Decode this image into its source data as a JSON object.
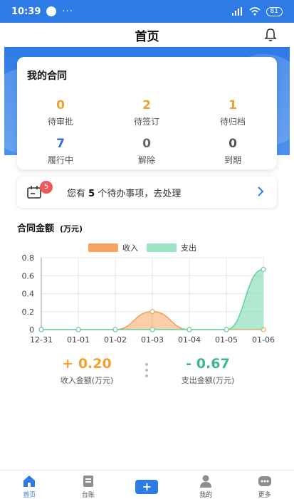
{
  "status_bar": {
    "time": "10:39",
    "dots": "···",
    "battery": "81"
  },
  "nav": {
    "title": "首页"
  },
  "contract_card": {
    "title": "我的合同",
    "stats": [
      {
        "value": "0",
        "label": "待审批",
        "color": "#f0a030"
      },
      {
        "value": "2",
        "label": "待签订",
        "color": "#f0a030"
      },
      {
        "value": "1",
        "label": "待归档",
        "color": "#f0a030"
      },
      {
        "value": "7",
        "label": "履行中",
        "color": "#2f6fd0"
      },
      {
        "value": "0",
        "label": "解除",
        "color": "#666666"
      },
      {
        "value": "0",
        "label": "到期",
        "color": "#555555"
      }
    ]
  },
  "todo": {
    "badge": "5",
    "prefix": "您有 ",
    "count": "5",
    "suffix": " 个待办事项，去处理"
  },
  "amount": {
    "title": "合同金额",
    "unit": "(万元)"
  },
  "chart_data": {
    "type": "area",
    "x": [
      "12-31",
      "01-01",
      "01-02",
      "01-03",
      "01-04",
      "01-05",
      "01-06"
    ],
    "series": [
      {
        "name": "收入",
        "values": [
          0,
          0,
          0,
          0.2,
          0,
          0,
          0
        ],
        "color": "#f5a55f"
      },
      {
        "name": "支出",
        "values": [
          0,
          0,
          0,
          0,
          0,
          0,
          0.67
        ],
        "color": "#7bd9b0"
      }
    ],
    "yticks": [
      "0",
      "0.2",
      "0.4",
      "0.6",
      "0.8"
    ],
    "ylim": [
      0,
      0.8
    ],
    "grid": true,
    "legend": "top-center"
  },
  "totals": {
    "income": {
      "value": "+ 0.20",
      "label": "收入金额(万元)",
      "color": "#f0a030"
    },
    "expense": {
      "value": "- 0.67",
      "label": "支出金额(万元)",
      "color": "#3cb88a"
    }
  },
  "tabs": [
    {
      "label": "首页",
      "icon": "home-icon"
    },
    {
      "label": "台账",
      "icon": "ledger-icon"
    },
    {
      "label": "+",
      "icon": "plus-icon"
    },
    {
      "label": "我的",
      "icon": "user-icon"
    },
    {
      "label": "更多",
      "icon": "more-icon"
    }
  ]
}
